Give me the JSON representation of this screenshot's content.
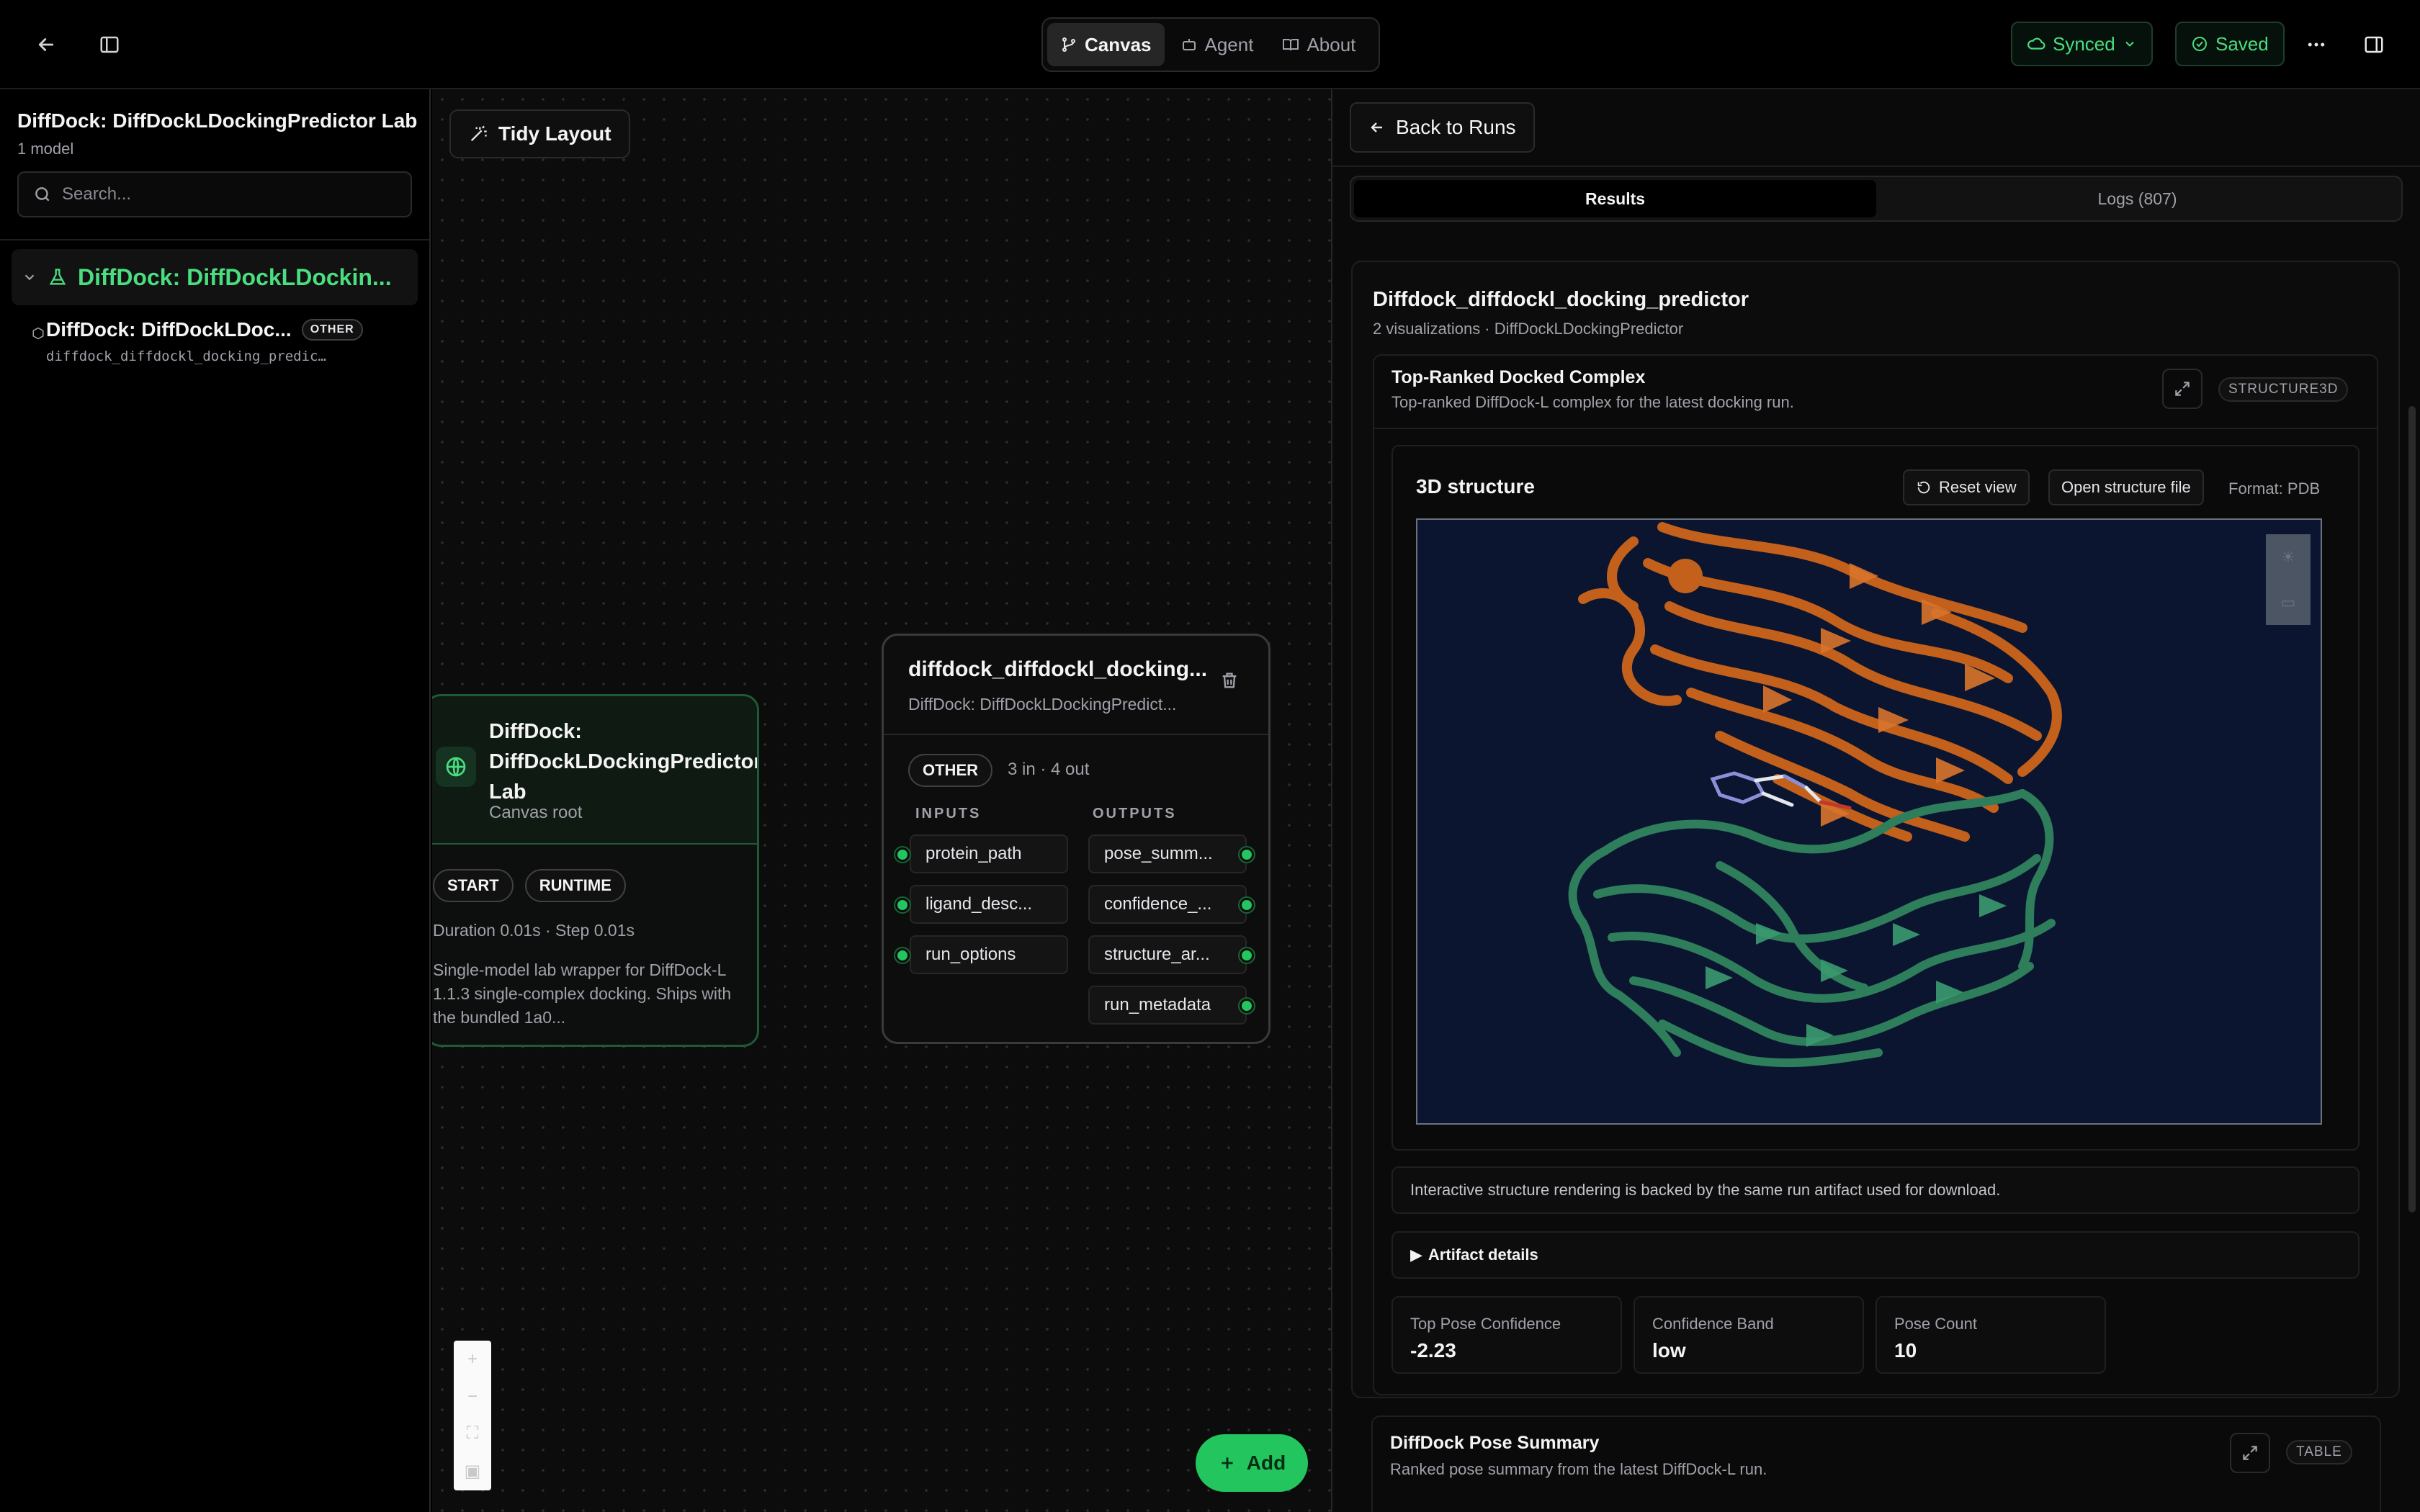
{
  "topbar": {
    "tabs": [
      {
        "label": "Canvas",
        "icon": "git-branch-icon",
        "active": true
      },
      {
        "label": "Agent",
        "icon": "bot-icon",
        "active": false
      },
      {
        "label": "About",
        "icon": "book-icon",
        "active": false
      }
    ],
    "synced_label": "Synced",
    "saved_label": "Saved"
  },
  "sidebar": {
    "title": "DiffDock: DiffDockLDockingPredictor Lab",
    "subtitle": "1 model",
    "search_placeholder": "Search...",
    "group_label": "DiffDock: DiffDockLDockin...",
    "item": {
      "title": "DiffDock: DiffDockLDoc...",
      "tag": "OTHER",
      "mono": "diffdock_diffdockl_docking_predic…"
    }
  },
  "canvas": {
    "tidy_label": "Tidy Layout",
    "root_node": {
      "title": "DiffDock: DiffDockLDockingPredictor Lab",
      "subtitle": "Canvas root",
      "chips": [
        "START",
        "RUNTIME"
      ],
      "meta": "Duration 0.01s · Step 0.01s",
      "description": "Single-model lab wrapper for DiffDock-L 1.1.3 single-complex docking. Ships with the bundled 1a0..."
    },
    "model_node": {
      "title": "diffdock_diffdockl_docking...",
      "subtitle": "DiffDock: DiffDockLDockingPredict...",
      "tag": "OTHER",
      "stats": "3 in · 4 out",
      "inputs_label": "INPUTS",
      "outputs_label": "OUTPUTS",
      "inputs": [
        "protein_path",
        "ligand_desc...",
        "run_options"
      ],
      "outputs": [
        "pose_summ...",
        "confidence_...",
        "structure_ar...",
        "run_metadata"
      ]
    },
    "add_label": "Add"
  },
  "results": {
    "back_label": "Back to Runs",
    "tabs": [
      {
        "label": "Results",
        "active": true
      },
      {
        "label": "Logs (807)",
        "active": false
      }
    ],
    "card": {
      "title": "Diffdock_diffdockl_docking_predictor",
      "subtitle": "2 visualizations · DiffDockLDockingPredictor",
      "viz1": {
        "title": "Top-Ranked Docked Complex",
        "subtitle": "Top-ranked DiffDock-L complex for the latest docking run.",
        "type": "STRUCTURE3D",
        "structure_title": "3D structure",
        "reset_label": "Reset view",
        "open_label": "Open structure file",
        "format": "Format: PDB",
        "note": "Interactive structure rendering is backed by the same run artifact used for download.",
        "details_label": "Artifact details",
        "metrics": [
          {
            "label": "Top Pose Confidence",
            "value": "-2.23"
          },
          {
            "label": "Confidence Band",
            "value": "low"
          },
          {
            "label": "Pose Count",
            "value": "10"
          }
        ]
      },
      "viz2": {
        "title": "DiffDock Pose Summary",
        "subtitle": "Ranked pose summary from the latest DiffDock-L run.",
        "type": "TABLE"
      }
    }
  },
  "colors": {
    "accent": "#22c55e",
    "protein_chain_a": "#c2601c",
    "protein_chain_b": "#2e7d5b",
    "viewer_bg": "#0b1530"
  }
}
